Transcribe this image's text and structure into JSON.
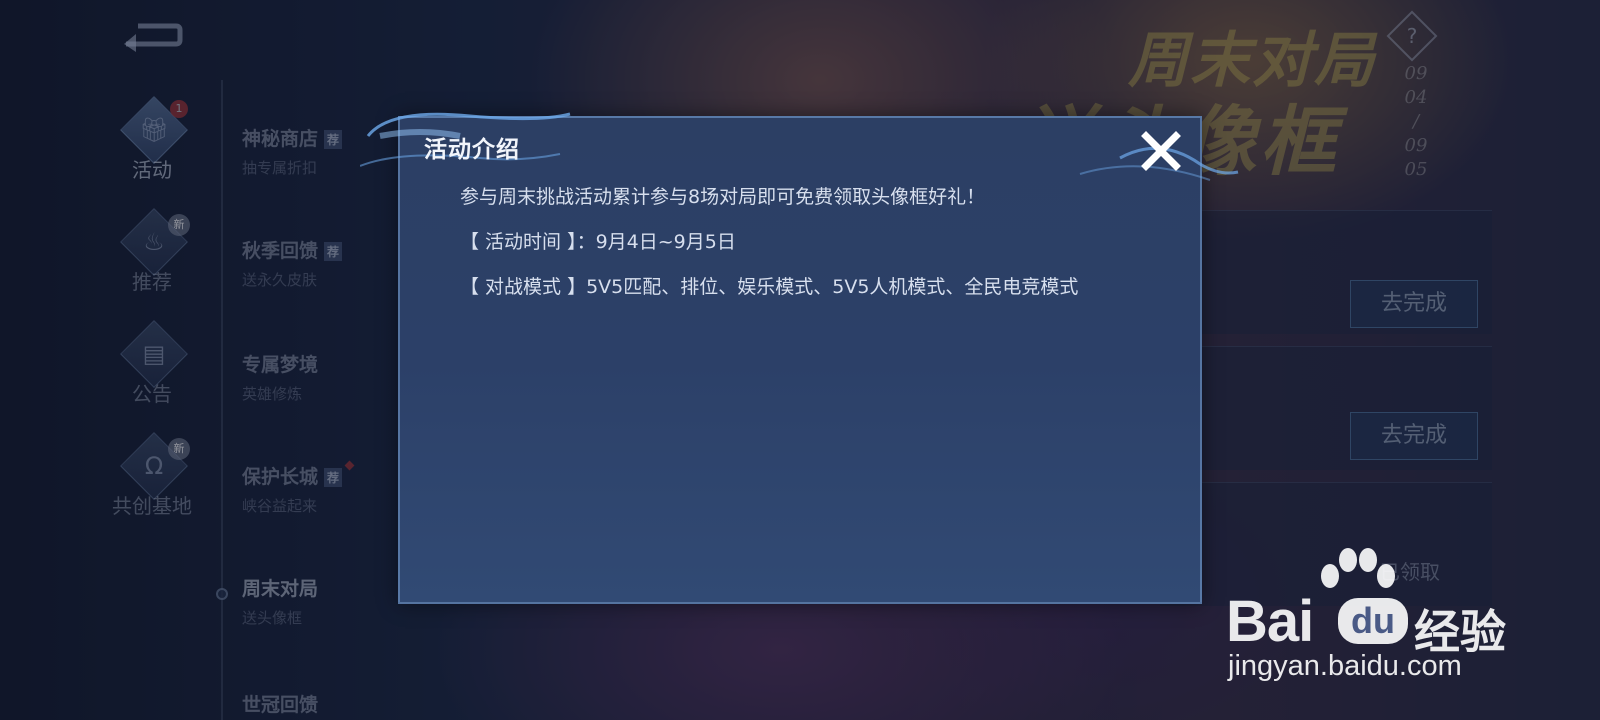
{
  "nav": {
    "categories": [
      {
        "label": "活动",
        "badge": "1",
        "icon": "gift-icon"
      },
      {
        "label": "推荐",
        "badge": "新",
        "icon": "flame-icon"
      },
      {
        "label": "公告",
        "badge": "",
        "icon": "calendar-icon"
      },
      {
        "label": "共创基地",
        "badge": "新",
        "icon": "co-create-icon"
      }
    ]
  },
  "activities": [
    {
      "title": "神秘商店",
      "subtitle": "抽专属折扣",
      "tag": "荐"
    },
    {
      "title": "秋季回馈",
      "subtitle": "送永久皮肤",
      "tag": "荐"
    },
    {
      "title": "专属梦境",
      "subtitle": "英雄修炼",
      "tag": ""
    },
    {
      "title": "保护长城",
      "subtitle": "峡谷益起来",
      "tag": "荐"
    },
    {
      "title": "周末对局",
      "subtitle": "送头像框",
      "tag": ""
    },
    {
      "title": "世冠回馈",
      "subtitle": "",
      "tag": ""
    }
  ],
  "banner": {
    "line1": "周末对局",
    "line2": "送头像框",
    "help": "?",
    "dates": [
      "09",
      "04",
      "/",
      "09",
      "05"
    ]
  },
  "tasks": {
    "button_label": "去完成",
    "claimed_label": "已领取"
  },
  "modal": {
    "title": "活动介绍",
    "lines": [
      "参与周末挑战活动累计参与8场对局即可免费领取头像框好礼！",
      "【 活动时间 】：9月4日~9月5日",
      "【 对战模式 】5V5匹配、排位、娱乐模式、5V5人机模式、全民电竞模式"
    ]
  },
  "watermark": {
    "brand": "Bai",
    "du": "du",
    "product": "经验",
    "url": "jingyan.baidu.com"
  },
  "colors": {
    "modal_bg": "#2c4068",
    "modal_border": "#78a0d2",
    "accent_gold": "#d2be5a",
    "badge_red": "#c23b3b"
  }
}
